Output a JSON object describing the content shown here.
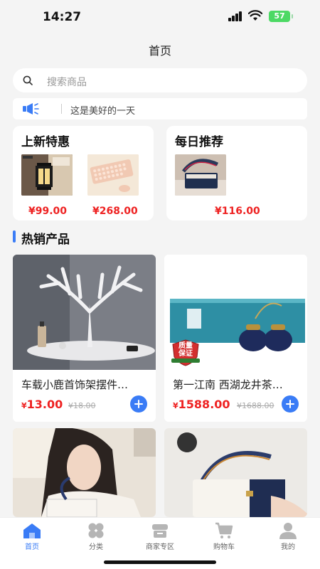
{
  "status_bar": {
    "time": "14:27",
    "battery": "57"
  },
  "header": {
    "title": "首页"
  },
  "search": {
    "placeholder": "搜索商品"
  },
  "notice": {
    "text": "这是美好的一天"
  },
  "promo_new": {
    "title": "上新特惠",
    "items": [
      {
        "image": "wall-lamp-image",
        "price": "¥99.00"
      },
      {
        "image": "pink-keyboard-image",
        "price": "¥268.00"
      }
    ]
  },
  "promo_daily": {
    "title": "每日推荐",
    "items": [
      {
        "image": "handbag-image",
        "price": "¥116.00"
      }
    ]
  },
  "hot_section": {
    "title": "热销产品"
  },
  "products": [
    {
      "name": "车载小鹿首饰架摆件…",
      "price": "13.00",
      "currency": "¥",
      "old_price": "¥18.00"
    },
    {
      "name": "第一江南 西湖龙井茶…",
      "price": "1588.00",
      "currency": "¥",
      "old_price": "¥1688.00",
      "badge_line1": "质量",
      "badge_line2": "保证"
    },
    {
      "name": "",
      "price": "",
      "old_price": ""
    },
    {
      "name": "",
      "price": "",
      "old_price": ""
    }
  ],
  "tabbar": {
    "items": [
      {
        "label": "首页",
        "icon": "home-icon",
        "active": true
      },
      {
        "label": "分类",
        "icon": "category-icon"
      },
      {
        "label": "商家专区",
        "icon": "shop-icon"
      },
      {
        "label": "购物车",
        "icon": "cart-icon"
      },
      {
        "label": "我的",
        "icon": "user-icon"
      }
    ]
  },
  "colors": {
    "accent": "#3a7cf6",
    "price": "#e22222",
    "background": "#f4f4f4"
  }
}
